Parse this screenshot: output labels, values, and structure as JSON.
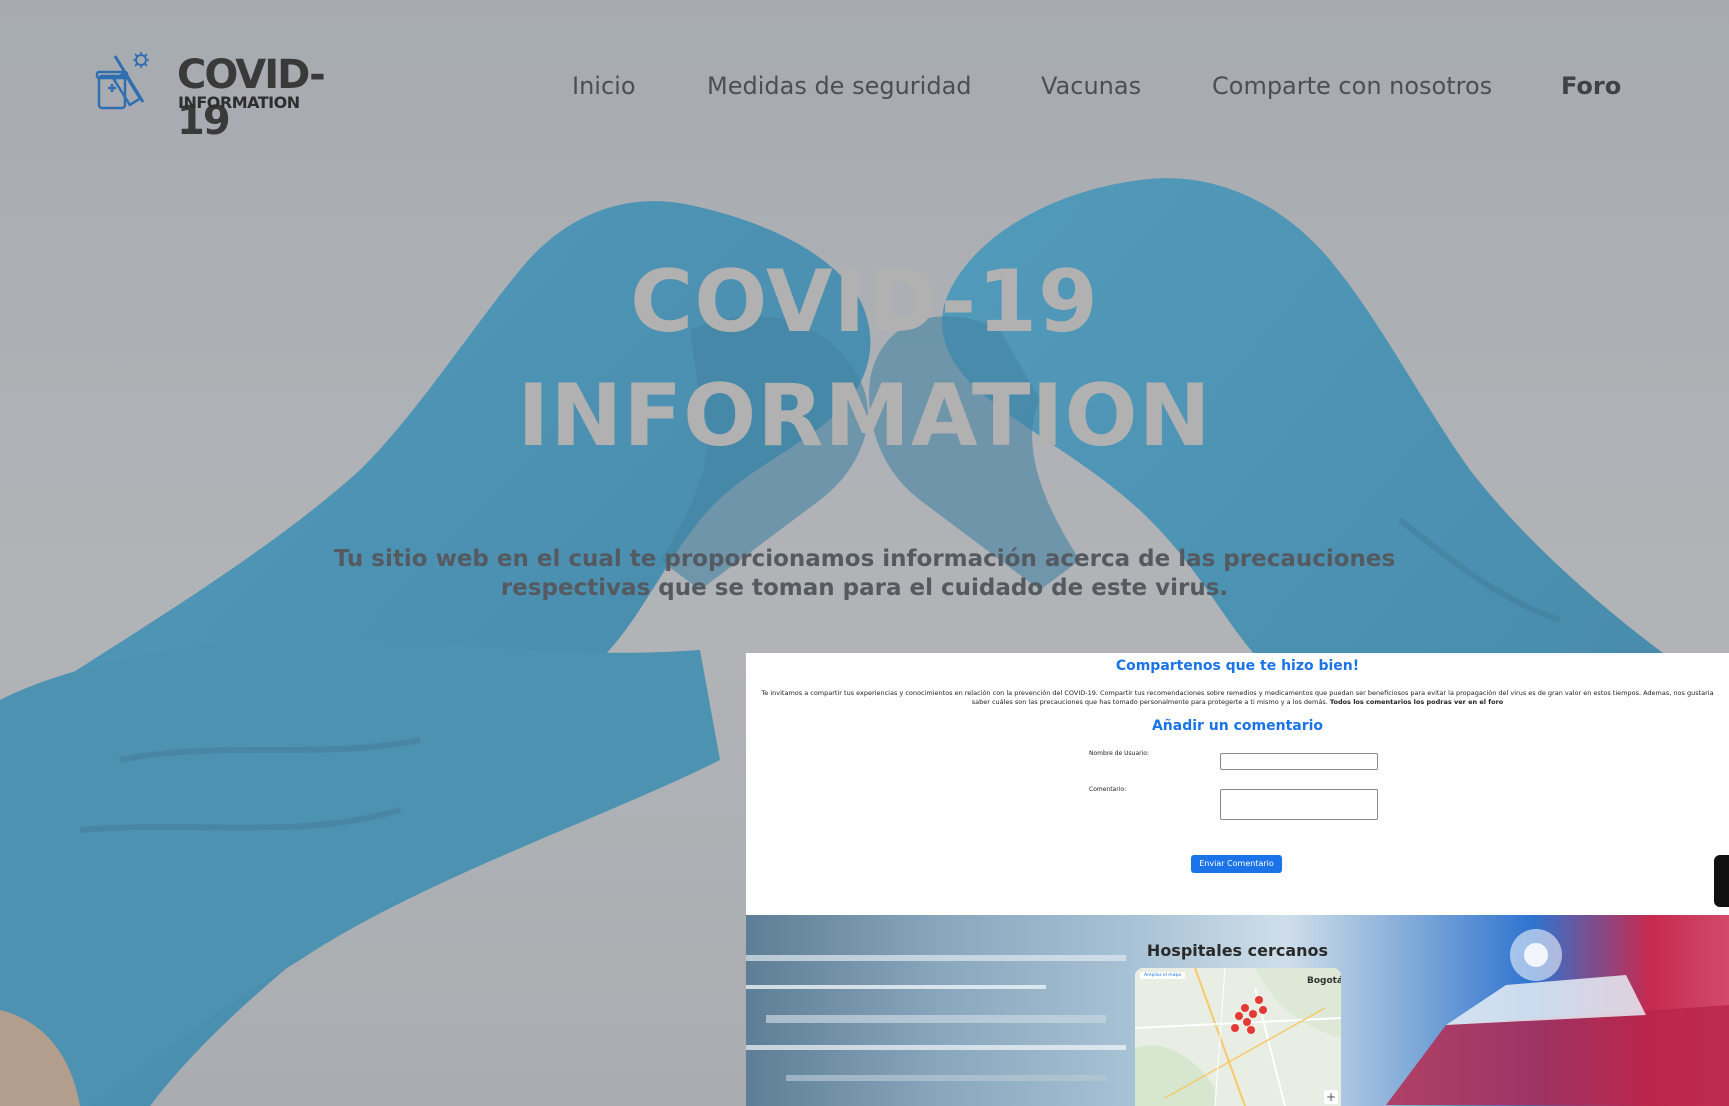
{
  "brand": {
    "title": "COVID-19",
    "subtitle": "INFORMATION"
  },
  "nav": {
    "items": [
      {
        "label": "Inicio",
        "active": false
      },
      {
        "label": "Medidas de seguridad",
        "active": false
      },
      {
        "label": "Vacunas",
        "active": false
      },
      {
        "label": "Comparte con nosotros",
        "active": false
      },
      {
        "label": "Foro",
        "active": true
      }
    ]
  },
  "hero": {
    "title_line1": "COVID-19",
    "title_line2": "INFORMATION",
    "subtitle": "Tu sitio web en el cual te proporcionamos información acerca de las precauciones respectivas que se toman para el cuidado de este virus."
  },
  "share": {
    "heading": "Compartenos que te hizo bien!",
    "intro": "Te invitamos a compartir tus experiencias y conocimientos en relación con la prevención del COVID-19. Compartir tus recomendaciones sobre remedios y medicamentos que puedan ser beneficiosos para evitar la propagación del virus es de gran valor en estos tiempos. Ademas, nos gustaria saber cuáles son las precauciones que has tomado personalmente para protegerte a ti mismo y a los demás.",
    "intro_bold": "Todos los comentarios los podras ver en el foro",
    "form_heading": "Añadir un comentario",
    "username_label": "Nombre de Usuario:",
    "username_value": "",
    "comment_label": "Comentario:",
    "comment_value": "",
    "submit_label": "Enviar Comentario"
  },
  "hospitals": {
    "heading": "Hospitales cercanos",
    "map": {
      "enlarge_label": "Ampliar el mapa",
      "city_label": "Bogotá",
      "zoom_in_label": "+"
    }
  },
  "colors": {
    "accent": "#1a73e8",
    "glove": "#3a8fb5",
    "overlay": "#aeb2b6"
  }
}
